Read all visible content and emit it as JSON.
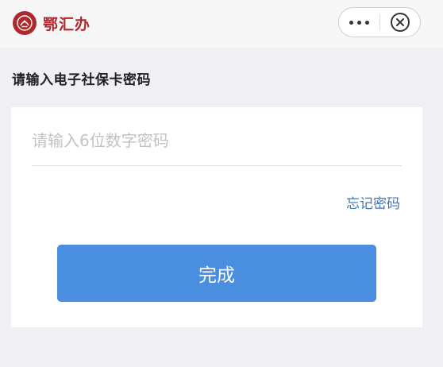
{
  "header": {
    "brand_name": "鄂汇办"
  },
  "section": {
    "title": "请输入电子社保卡密码"
  },
  "form": {
    "password_placeholder": "请输入6位数字密码",
    "password_value": "",
    "forgot_password_label": "忘记密码",
    "submit_label": "完成"
  },
  "colors": {
    "brand": "#b0272c",
    "link": "#3f77b8",
    "primary_button": "#4a8ee0",
    "background": "#efeff4"
  },
  "icons": {
    "brand_logo": "hubei-emblem-icon",
    "more": "more-dots-icon",
    "close": "close-circle-icon"
  }
}
